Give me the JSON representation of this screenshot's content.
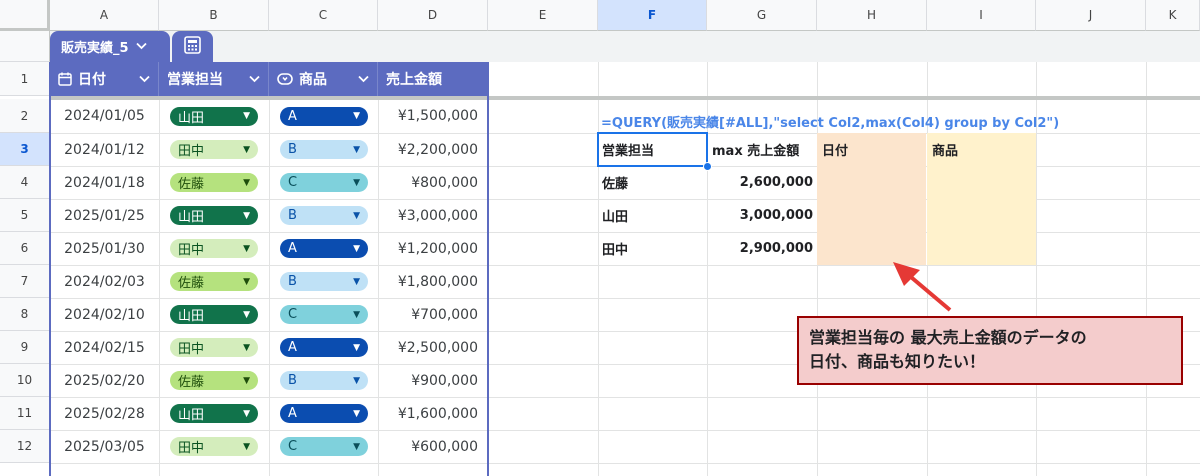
{
  "columns": [
    "A",
    "B",
    "C",
    "D",
    "E",
    "F",
    "G",
    "H",
    "I",
    "J",
    "K"
  ],
  "selected_column": "F",
  "rows": [
    "1",
    "2",
    "3",
    "4",
    "5",
    "6",
    "7",
    "8",
    "9",
    "10",
    "11",
    "12"
  ],
  "selected_row": "3",
  "table": {
    "tab_name": "販売実績_5",
    "headers": [
      "日付",
      "営業担当",
      "商品",
      "売上金額"
    ],
    "records": [
      {
        "date": "2024/01/05",
        "rep": "山田",
        "product": "A",
        "amount": "¥1,500,000"
      },
      {
        "date": "2024/01/12",
        "rep": "田中",
        "product": "B",
        "amount": "¥2,200,000"
      },
      {
        "date": "2024/01/18",
        "rep": "佐藤",
        "product": "C",
        "amount": "¥800,000"
      },
      {
        "date": "2025/01/25",
        "rep": "山田",
        "product": "B",
        "amount": "¥3,000,000"
      },
      {
        "date": "2025/01/30",
        "rep": "田中",
        "product": "A",
        "amount": "¥1,200,000"
      },
      {
        "date": "2024/02/03",
        "rep": "佐藤",
        "product": "B",
        "amount": "¥1,800,000"
      },
      {
        "date": "2024/02/10",
        "rep": "山田",
        "product": "C",
        "amount": "¥700,000"
      },
      {
        "date": "2024/02/15",
        "rep": "田中",
        "product": "A",
        "amount": "¥2,500,000"
      },
      {
        "date": "2025/02/20",
        "rep": "佐藤",
        "product": "B",
        "amount": "¥900,000"
      },
      {
        "date": "2025/02/28",
        "rep": "山田",
        "product": "A",
        "amount": "¥1,600,000"
      },
      {
        "date": "2025/03/05",
        "rep": "田中",
        "product": "C",
        "amount": "¥600,000"
      }
    ]
  },
  "chip_colors": {
    "山田": {
      "bg": "#11734b",
      "fg": "#ffffff"
    },
    "田中": {
      "bg": "#d4edbc",
      "fg": "#0a5321"
    },
    "佐藤": {
      "bg": "#b5e27e",
      "fg": "#1e4d0b"
    },
    "A": {
      "bg": "#0b4db0",
      "fg": "#ffffff"
    },
    "B": {
      "bg": "#bfe1f6",
      "fg": "#0a53a8"
    },
    "C": {
      "bg": "#7fd1dc",
      "fg": "#0a4f5a"
    }
  },
  "query": {
    "formula": "=QUERY(販売実績[#ALL],\"select Col2,max(Col4) group by Col2\")",
    "header_rep": "営業担当",
    "header_max": "max 売上金額",
    "header_date": "日付",
    "header_product": "商品",
    "results": [
      {
        "rep": "佐藤",
        "max": "2,600,000"
      },
      {
        "rep": "山田",
        "max": "3,000,000"
      },
      {
        "rep": "田中",
        "max": "2,900,000"
      }
    ]
  },
  "callout": {
    "line1": "営業担当毎の 最大売上金額のデータの",
    "line2": "日付、商品も知りたい！"
  }
}
